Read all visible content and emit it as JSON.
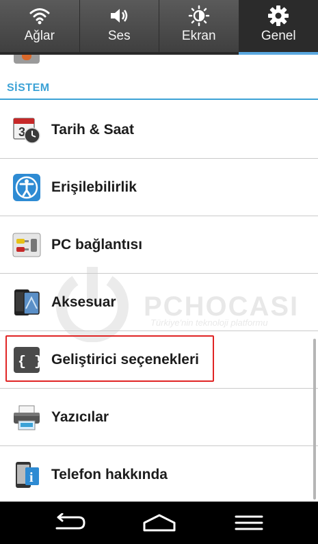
{
  "tabs": [
    {
      "label": "Ağlar",
      "icon": "wifi-icon",
      "active": false
    },
    {
      "label": "Ses",
      "icon": "speaker-icon",
      "active": false
    },
    {
      "label": "Ekran",
      "icon": "brightness-icon",
      "active": false
    },
    {
      "label": "Genel",
      "icon": "gear-icon",
      "active": true
    }
  ],
  "section": {
    "title": "SİSTEM"
  },
  "items": [
    {
      "label": "Tarih & Saat",
      "icon": "calendar-clock-icon"
    },
    {
      "label": "Erişilebilirlik",
      "icon": "accessibility-icon"
    },
    {
      "label": "PC bağlantısı",
      "icon": "pc-connection-icon"
    },
    {
      "label": "Aksesuar",
      "icon": "accessory-icon"
    },
    {
      "label": "Geliştirici seçenekleri",
      "icon": "developer-options-icon",
      "highlighted": true
    },
    {
      "label": "Yazıcılar",
      "icon": "printer-icon"
    },
    {
      "label": "Telefon hakkında",
      "icon": "phone-info-icon"
    }
  ],
  "watermark": {
    "brand": "PCHOCASI",
    "tagline": "Türkiye'nin teknoloji platformu"
  },
  "navbar": {
    "buttons": [
      "back-icon",
      "home-icon",
      "menu-icon"
    ]
  },
  "colors": {
    "accent": "#3ca2d6",
    "highlight_border": "#e02424",
    "tab_bg": "#4a4a4a",
    "active_tab_bg": "#2b2b2b"
  }
}
